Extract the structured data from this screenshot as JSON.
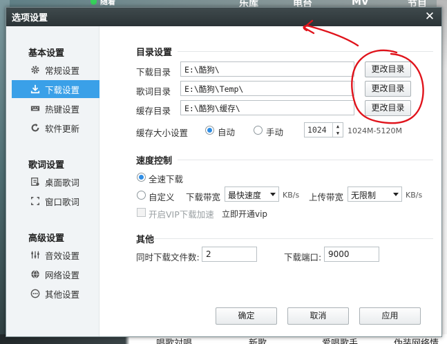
{
  "background": {
    "top_texts": [
      "随着",
      "乐库",
      "电台",
      "MV",
      "节目"
    ],
    "bottom_texts": [
      "唱歌対唱",
      "新歌",
      "爱唱歌手",
      "伪装网络情"
    ]
  },
  "dialog": {
    "title": "选项设置",
    "close_label": "✕"
  },
  "sidebar": {
    "groups": [
      {
        "heading": "基本设置",
        "items": [
          {
            "label": "常规设置",
            "icon": "gear-icon"
          },
          {
            "label": "下载设置",
            "icon": "download-icon",
            "active": true
          },
          {
            "label": "热键设置",
            "icon": "keyboard-icon"
          },
          {
            "label": "软件更新",
            "icon": "update-icon"
          }
        ]
      },
      {
        "heading": "歌词设置",
        "items": [
          {
            "label": "桌面歌词",
            "icon": "desktop-lyrics-icon"
          },
          {
            "label": "窗口歌词",
            "icon": "window-lyrics-icon"
          }
        ]
      },
      {
        "heading": "高级设置",
        "items": [
          {
            "label": "音效设置",
            "icon": "equalizer-icon"
          },
          {
            "label": "网络设置",
            "icon": "network-icon"
          },
          {
            "label": "其他设置",
            "icon": "more-icon"
          }
        ]
      }
    ]
  },
  "directory": {
    "section_title": "目录设置",
    "rows": [
      {
        "label": "下载目录",
        "value": "E:\\酷狗\\",
        "button": "更改目录"
      },
      {
        "label": "歌词目录",
        "value": "E:\\酷狗\\Temp\\",
        "button": "更改目录"
      },
      {
        "label": "缓存目录",
        "value": "E:\\酷狗\\缓存\\",
        "button": "更改目录"
      }
    ],
    "cache_size_label": "缓存大小设置",
    "cache_auto_label": "自动",
    "cache_manual_label": "手动",
    "cache_size_value": "1024",
    "cache_range": "1024M-5120M"
  },
  "speed": {
    "section_title": "速度控制",
    "full_speed_label": "全速下载",
    "custom_label": "自定义",
    "download_bw_label": "下载带宽",
    "download_bw_value": "最快速度",
    "download_unit": "KB/s",
    "upload_bw_label": "上传带宽",
    "upload_bw_value": "无限制",
    "upload_unit": "KB/s",
    "vip_checkbox_label": "开启VIP下载加速",
    "vip_link": "立即开通vip"
  },
  "other": {
    "section_title": "其他",
    "concurrent_label": "同时下载文件数:",
    "concurrent_value": "2",
    "port_label": "下载端口:",
    "port_value": "9000"
  },
  "footer": {
    "ok": "确定",
    "cancel": "取消",
    "apply": "应用"
  },
  "colors": {
    "accent": "#3aa0e8",
    "annotation": "#e0131b"
  }
}
